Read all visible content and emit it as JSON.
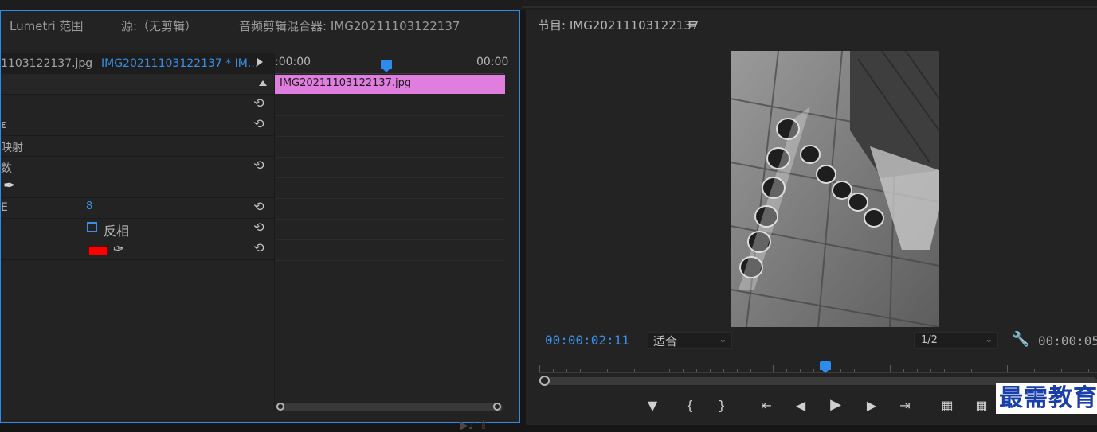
{
  "left_panel": {
    "tabs": [
      "Lumetri 范围",
      "源:（无剪辑）",
      "音频剪辑混合器: IMG20211103122137"
    ],
    "source_left": "1103122137.jpg",
    "source_right": "IMG20211103122137 * IM...",
    "rows": [
      {
        "label": ""
      },
      {
        "label": ""
      },
      {
        "label": "ɛ"
      },
      {
        "label": "映射"
      },
      {
        "label": "数"
      },
      {
        "label": ""
      },
      {
        "label": "E",
        "value": "8"
      },
      {
        "label": "",
        "checkbox_label": "反相"
      },
      {
        "label": ""
      }
    ],
    "timeline": {
      "time_start": ":00:00",
      "time_end": "00:00",
      "clip_name": "IMG20211103122137.jpg"
    },
    "colors": {
      "accent": "#2d8ceb",
      "clip": "#e07ee0",
      "swatch": "#ff0000"
    }
  },
  "program": {
    "title": "节目: IMG20211103122137",
    "menu_icon": "≡",
    "timecode": "00:00:02:11",
    "fit": "适合",
    "resolution": "1/2",
    "duration": "00:00:05",
    "controls": [
      "add-marker",
      "mark-in",
      "mark-out",
      "go-to-in",
      "step-back",
      "play",
      "step-forward",
      "go-to-out",
      "insert",
      "overwrite"
    ]
  },
  "watermark": "最需教育"
}
